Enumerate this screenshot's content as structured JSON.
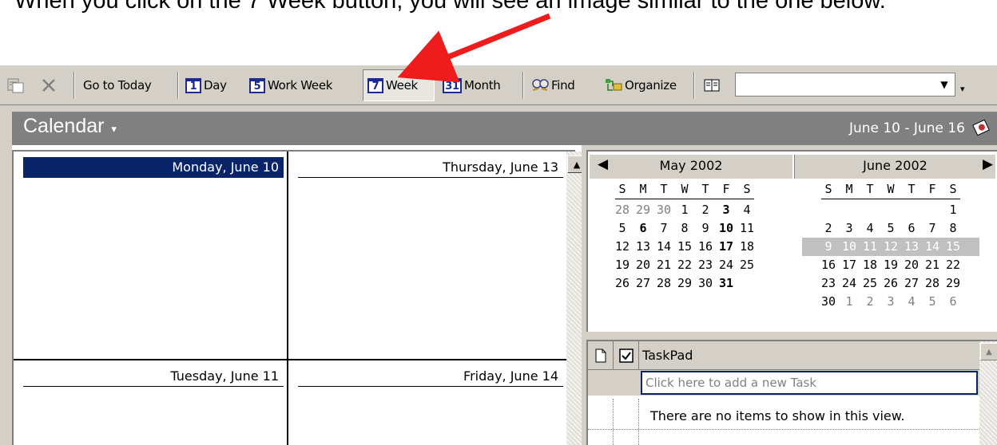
{
  "caption": "When you click on the 7 Week button, you will see an image similar to the one below.",
  "colors": {
    "arrow": "#ee1c1c",
    "selection": "#0a246a",
    "banner": "#808080",
    "chrome": "#d4d0c8"
  },
  "toolbar": {
    "icons": [
      "move-to-folder-icon",
      "delete-icon"
    ],
    "go_to_today": "Go to Today",
    "day": {
      "num": "1",
      "label": "Day"
    },
    "work_week": {
      "num": "5",
      "label": "Work Week"
    },
    "week": {
      "num": "7",
      "label": "Week"
    },
    "month": {
      "num": "31",
      "label": "Month"
    },
    "find": "Find",
    "organize": "Organize",
    "dropdown_value": ""
  },
  "banner": {
    "title": "Calendar",
    "range": "June 10 - June 16"
  },
  "days": [
    {
      "label": "Monday, June 10",
      "selected": true
    },
    {
      "label": "Thursday, June 13",
      "selected": false
    },
    {
      "label": "Tuesday, June 11",
      "selected": false
    },
    {
      "label": "Friday, June 14",
      "selected": false
    }
  ],
  "navigator": {
    "months": [
      {
        "title": "May 2002",
        "dow": [
          "S",
          "M",
          "T",
          "W",
          "T",
          "F",
          "S"
        ],
        "weeks": [
          [
            {
              "d": "28",
              "dim": true
            },
            {
              "d": "29",
              "dim": true
            },
            {
              "d": "30",
              "dim": true
            },
            {
              "d": "1"
            },
            {
              "d": "2"
            },
            {
              "d": "3",
              "bold": true
            },
            {
              "d": "4"
            }
          ],
          [
            {
              "d": "5"
            },
            {
              "d": "6",
              "bold": true
            },
            {
              "d": "7"
            },
            {
              "d": "8"
            },
            {
              "d": "9"
            },
            {
              "d": "10",
              "bold": true
            },
            {
              "d": "11"
            }
          ],
          [
            {
              "d": "12"
            },
            {
              "d": "13"
            },
            {
              "d": "14"
            },
            {
              "d": "15"
            },
            {
              "d": "16"
            },
            {
              "d": "17",
              "bold": true
            },
            {
              "d": "18"
            }
          ],
          [
            {
              "d": "19"
            },
            {
              "d": "20"
            },
            {
              "d": "21"
            },
            {
              "d": "22"
            },
            {
              "d": "23"
            },
            {
              "d": "24"
            },
            {
              "d": "25"
            }
          ],
          [
            {
              "d": "26"
            },
            {
              "d": "27"
            },
            {
              "d": "28"
            },
            {
              "d": "29"
            },
            {
              "d": "30"
            },
            {
              "d": "31",
              "bold": true
            },
            {
              "d": ""
            }
          ]
        ]
      },
      {
        "title": "June 2002",
        "dow": [
          "S",
          "M",
          "T",
          "W",
          "T",
          "F",
          "S"
        ],
        "weeks": [
          [
            {
              "d": ""
            },
            {
              "d": ""
            },
            {
              "d": ""
            },
            {
              "d": ""
            },
            {
              "d": ""
            },
            {
              "d": ""
            },
            {
              "d": "1"
            }
          ],
          [
            {
              "d": "2"
            },
            {
              "d": "3"
            },
            {
              "d": "4"
            },
            {
              "d": "5"
            },
            {
              "d": "6"
            },
            {
              "d": "7"
            },
            {
              "d": "8"
            }
          ],
          [
            {
              "d": "9",
              "sel": true
            },
            {
              "d": "10",
              "sel": true
            },
            {
              "d": "11",
              "sel": true
            },
            {
              "d": "12",
              "sel": true
            },
            {
              "d": "13",
              "sel": true
            },
            {
              "d": "14",
              "sel": true
            },
            {
              "d": "15",
              "sel": true
            }
          ],
          [
            {
              "d": "16"
            },
            {
              "d": "17"
            },
            {
              "d": "18"
            },
            {
              "d": "19"
            },
            {
              "d": "20"
            },
            {
              "d": "21"
            },
            {
              "d": "22"
            }
          ],
          [
            {
              "d": "23"
            },
            {
              "d": "24"
            },
            {
              "d": "25"
            },
            {
              "d": "26"
            },
            {
              "d": "27"
            },
            {
              "d": "28"
            },
            {
              "d": "29"
            }
          ],
          [
            {
              "d": "30"
            },
            {
              "d": "1",
              "dim": true
            },
            {
              "d": "2",
              "dim": true
            },
            {
              "d": "3",
              "dim": true
            },
            {
              "d": "4",
              "dim": true
            },
            {
              "d": "5",
              "dim": true
            },
            {
              "d": "6",
              "dim": true
            }
          ]
        ]
      }
    ]
  },
  "taskpad": {
    "title": "TaskPad",
    "new_task_placeholder": "Click here to add a new Task",
    "empty_message": "There are no items to show in this view."
  }
}
